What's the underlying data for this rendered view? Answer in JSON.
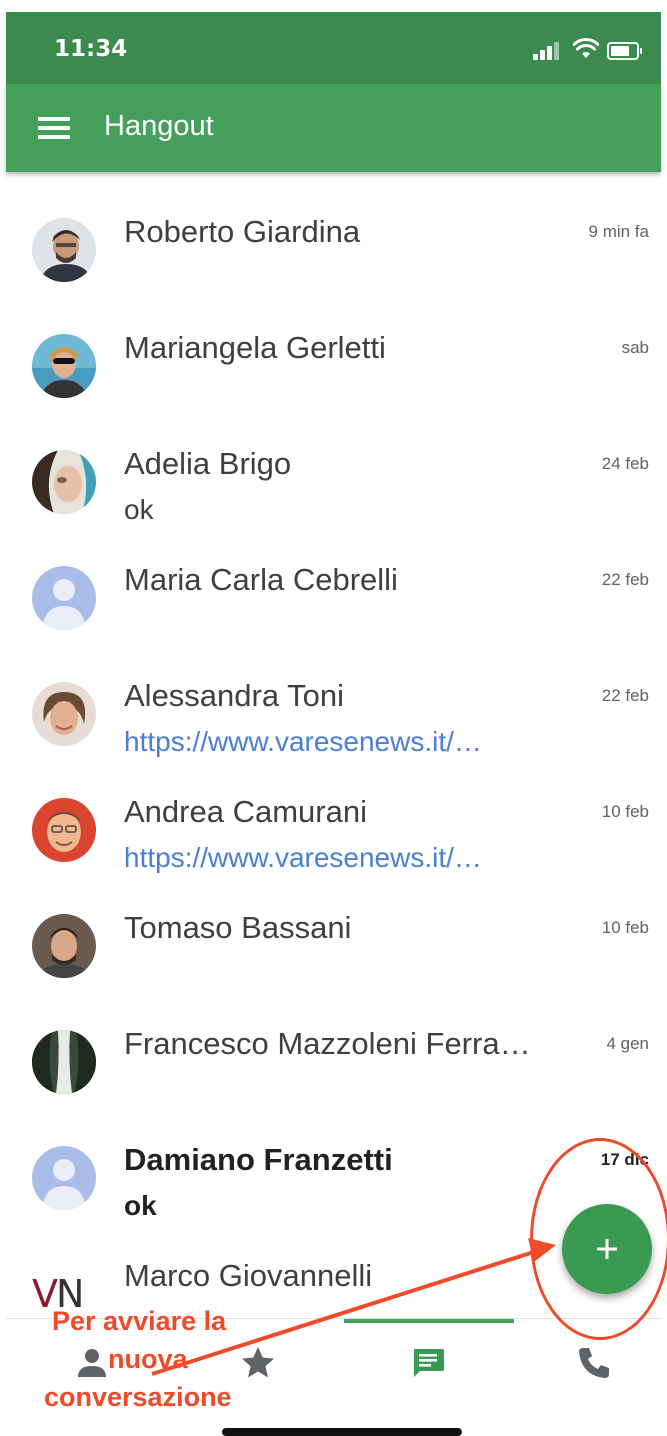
{
  "status": {
    "time": "11:34"
  },
  "appbar": {
    "title": "Hangout"
  },
  "conversations": [
    {
      "name": "Roberto Giardina",
      "time": "9 min fa",
      "snippet": "",
      "avatar": "photo"
    },
    {
      "name": "Mariangela Gerletti",
      "time": "sab",
      "snippet": "",
      "avatar": "photo"
    },
    {
      "name": "Adelia Brigo",
      "time": "24 feb",
      "snippet": "ok",
      "avatar": "photo"
    },
    {
      "name": "Maria Carla Cebrelli",
      "time": "22 feb",
      "snippet": "",
      "avatar": "default-avatar"
    },
    {
      "name": "Alessandra Toni",
      "time": "22 feb",
      "snippet": "https://www.varesenews.it/…",
      "avatar": "photo"
    },
    {
      "name": "Andrea Camurani",
      "time": "10 feb",
      "snippet": "https://www.varesenews.it/…",
      "avatar": "photo"
    },
    {
      "name": "Tomaso Bassani",
      "time": "10 feb",
      "snippet": "",
      "avatar": "photo"
    },
    {
      "name": "Francesco Mazzoleni Ferra…",
      "time": "4 gen",
      "snippet": "",
      "avatar": "photo"
    },
    {
      "name": "Damiano Franzetti",
      "time": "17 dic",
      "snippet": "ok",
      "avatar": "default-avatar",
      "unread": true
    },
    {
      "name": "Marco Giovannelli",
      "time": "",
      "snippet": "",
      "avatar": "logo"
    }
  ],
  "logo_text": {
    "first": "V",
    "second": "N"
  },
  "bottom_nav": [
    "contacts-icon",
    "star-icon",
    "chat-icon",
    "phone-icon"
  ],
  "annotation": {
    "line1": "Per avviare la",
    "line2": "nuova",
    "line3": "conversazione"
  },
  "colors": {
    "status_bar": "#3b8a4e",
    "app_bar": "#45a05c",
    "fab": "#3b9a52",
    "link": "#4a7fd4",
    "annotation": "#ef4a2a"
  }
}
